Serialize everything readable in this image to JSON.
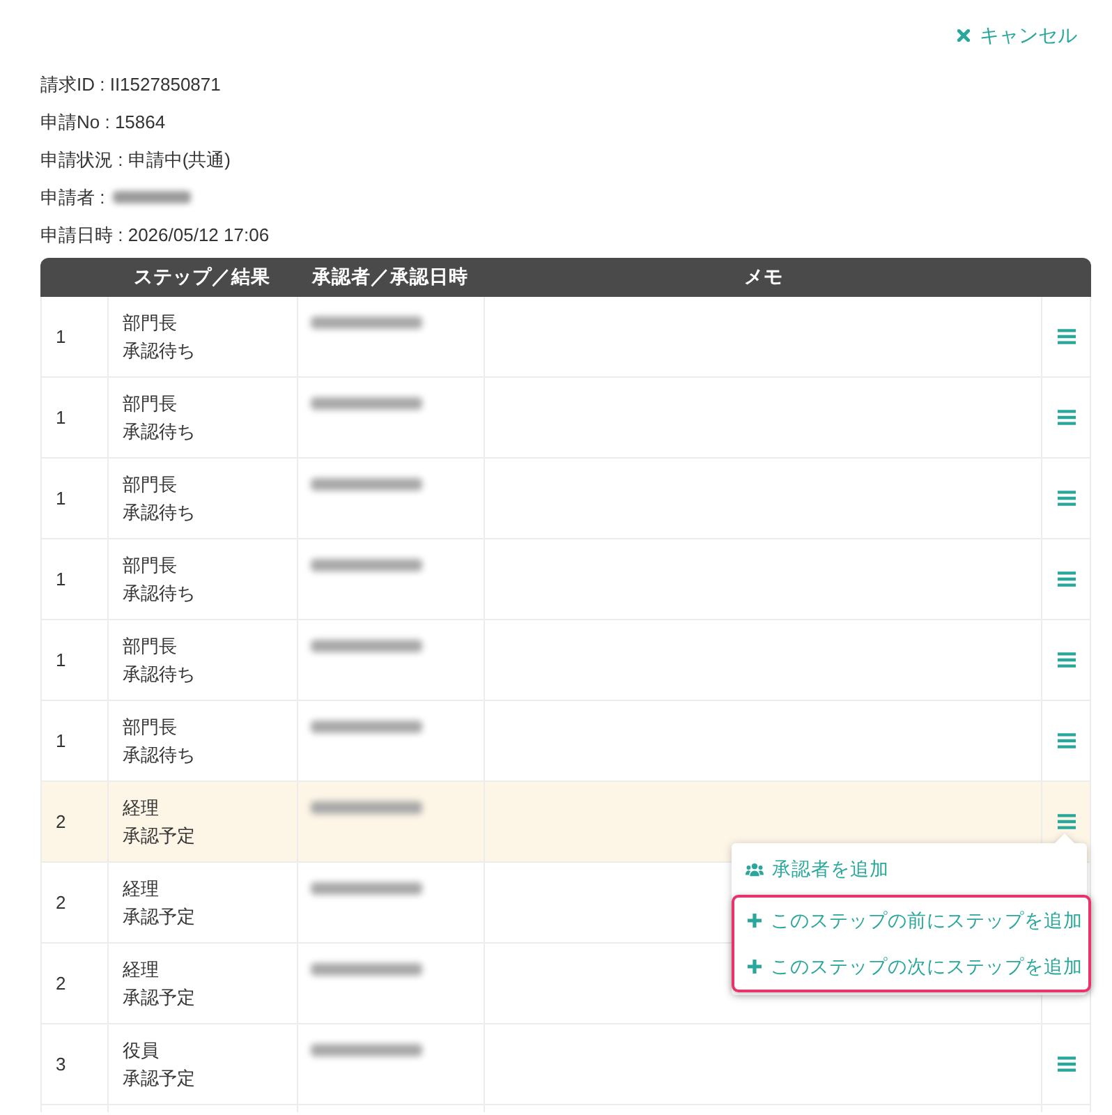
{
  "cancel_link": {
    "label": "キャンセル"
  },
  "info": [
    {
      "text": "請求ID : II1527850871",
      "redacted": false
    },
    {
      "text": "申請No : 15864",
      "redacted": false
    },
    {
      "text": "申請状況 : 申請中(共通)",
      "redacted": false
    },
    {
      "text": "申請者 :",
      "redacted": true
    },
    {
      "text": "申請日時 : 2026/05/12 17:06",
      "redacted": false
    }
  ],
  "table": {
    "columns": [
      "ステップ／結果",
      "承認者／承認日時",
      "メモ"
    ],
    "rows": [
      {
        "step": "1",
        "role": "部門長",
        "status": "承認待ち",
        "approver_redacted": true,
        "selected": false,
        "menu_open": false
      },
      {
        "step": "1",
        "role": "部門長",
        "status": "承認待ち",
        "approver_redacted": true,
        "selected": false,
        "menu_open": false
      },
      {
        "step": "1",
        "role": "部門長",
        "status": "承認待ち",
        "approver_redacted": true,
        "selected": false,
        "menu_open": false
      },
      {
        "step": "1",
        "role": "部門長",
        "status": "承認待ち",
        "approver_redacted": true,
        "selected": false,
        "menu_open": false
      },
      {
        "step": "1",
        "role": "部門長",
        "status": "承認待ち",
        "approver_redacted": true,
        "selected": false,
        "menu_open": false
      },
      {
        "step": "1",
        "role": "部門長",
        "status": "承認待ち",
        "approver_redacted": true,
        "selected": false,
        "menu_open": false
      },
      {
        "step": "2",
        "role": "経理",
        "status": "承認予定",
        "approver_redacted": true,
        "selected": true,
        "menu_open": true
      },
      {
        "step": "2",
        "role": "経理",
        "status": "承認予定",
        "approver_redacted": true,
        "selected": false,
        "menu_open": false
      },
      {
        "step": "2",
        "role": "経理",
        "status": "承認予定",
        "approver_redacted": true,
        "selected": false,
        "menu_open": false
      },
      {
        "step": "3",
        "role": "役員",
        "status": "承認予定",
        "approver_redacted": true,
        "selected": false,
        "menu_open": false
      }
    ],
    "row_menu": {
      "items": [
        {
          "kind": "users",
          "label": "承認者を追加",
          "emphasized": false
        },
        {
          "kind": "plus",
          "label": "このステップの前にステップを追加",
          "emphasized": true
        },
        {
          "kind": "plus",
          "label": "このステップの次にステップを追加",
          "emphasized": true
        }
      ]
    }
  }
}
